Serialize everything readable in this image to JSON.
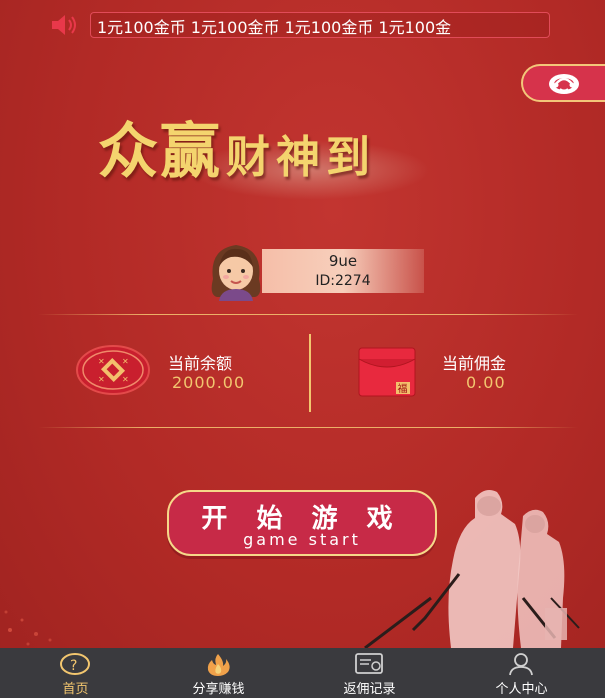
{
  "marquee": {
    "text": "1元100金币 1元100金币 1元100金币 1元100金"
  },
  "header": {
    "title_big": "众赢",
    "title_small": "财神到"
  },
  "user": {
    "name": "9ue",
    "id": "ID:2274"
  },
  "stats": {
    "balance_label": "当前余额",
    "balance_value": "2000.00",
    "commission_label": "当前佣金",
    "commission_value": "0.00",
    "envelope_char": "福"
  },
  "start_button": {
    "label_cn": "开 始 游 戏",
    "label_en": "game start"
  },
  "nav": {
    "items": [
      {
        "label": "首页",
        "icon": "question-circle-icon",
        "active": true
      },
      {
        "label": "分享赚钱",
        "icon": "fire-icon",
        "active": false
      },
      {
        "label": "返佣记录",
        "icon": "certificate-icon",
        "active": false
      },
      {
        "label": "个人中心",
        "icon": "user-icon",
        "active": false
      }
    ]
  },
  "colors": {
    "background": "#b22a26",
    "accent_gold": "#f2c66f",
    "button_pink": "#c72a47",
    "nav_bg": "#3a3a3e"
  }
}
